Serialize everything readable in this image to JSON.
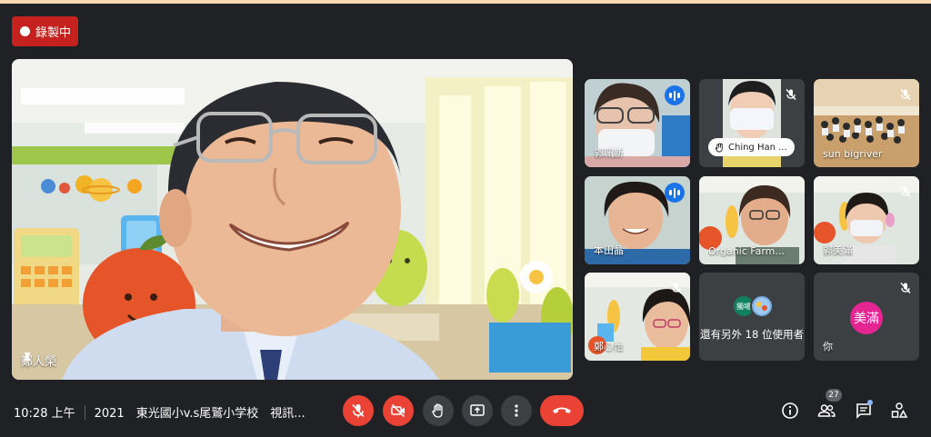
{
  "recording": {
    "label": "錄製中"
  },
  "main": {
    "name": "鄭人榮"
  },
  "tiles": [
    {
      "name": "郭珮新",
      "status": "speaking"
    },
    {
      "name": "Ching Han ...",
      "status": "hand"
    },
    {
      "name": "sun bigriver",
      "status": "muted"
    },
    {
      "name": "本田晶",
      "status": "speaking"
    },
    {
      "name": "Organic Farm...",
      "status": "none"
    },
    {
      "name": "郭美滿",
      "status": "muted"
    },
    {
      "name": "鄭心怡",
      "status": "muted"
    },
    {
      "name": "還有另外 18 位使用者",
      "status": "others"
    },
    {
      "name": "你",
      "status": "muted",
      "avatar": "美滿"
    }
  ],
  "others": {
    "mini_avatar_label": "獨場"
  },
  "bottom": {
    "time": "10:28 上午",
    "meeting_title": "2021　東光國小v.s尾鷲小学校　視訊...",
    "participant_count": "27"
  },
  "colors": {
    "record_red": "#c5221f",
    "speaking_blue": "#1a73e8",
    "control_red": "#ea4335",
    "avatar_pink": "#e52592"
  }
}
